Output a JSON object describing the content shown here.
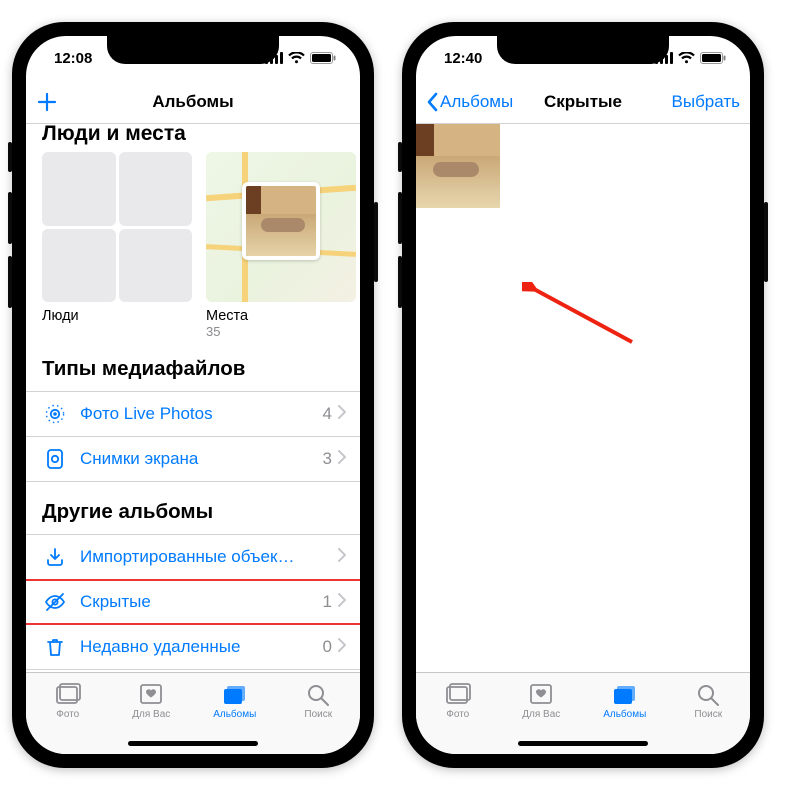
{
  "left": {
    "status_time": "12:08",
    "nav_title": "Альбомы",
    "section_people_places": "Люди и места",
    "album_people": "Люди",
    "album_places": "Места",
    "album_places_count": "35",
    "section_media_types": "Типы медиафайлов",
    "rows_media": [
      {
        "icon": "livephoto",
        "label": "Фото Live Photos",
        "count": "4"
      },
      {
        "icon": "screenshot",
        "label": "Снимки экрана",
        "count": "3"
      }
    ],
    "section_other": "Другие альбомы",
    "rows_other": [
      {
        "icon": "import",
        "label": "Импортированные объек…",
        "count": ""
      },
      {
        "icon": "hidden",
        "label": "Скрытые",
        "count": "1",
        "highlight": true
      },
      {
        "icon": "trash",
        "label": "Недавно удаленные",
        "count": "0"
      }
    ]
  },
  "right": {
    "status_time": "12:40",
    "back_label": "Альбомы",
    "nav_title": "Скрытые",
    "select_label": "Выбрать"
  },
  "tabs": [
    {
      "key": "photos",
      "label": "Фото"
    },
    {
      "key": "foryou",
      "label": "Для Вас"
    },
    {
      "key": "albums",
      "label": "Альбомы",
      "active": true
    },
    {
      "key": "search",
      "label": "Поиск"
    }
  ]
}
